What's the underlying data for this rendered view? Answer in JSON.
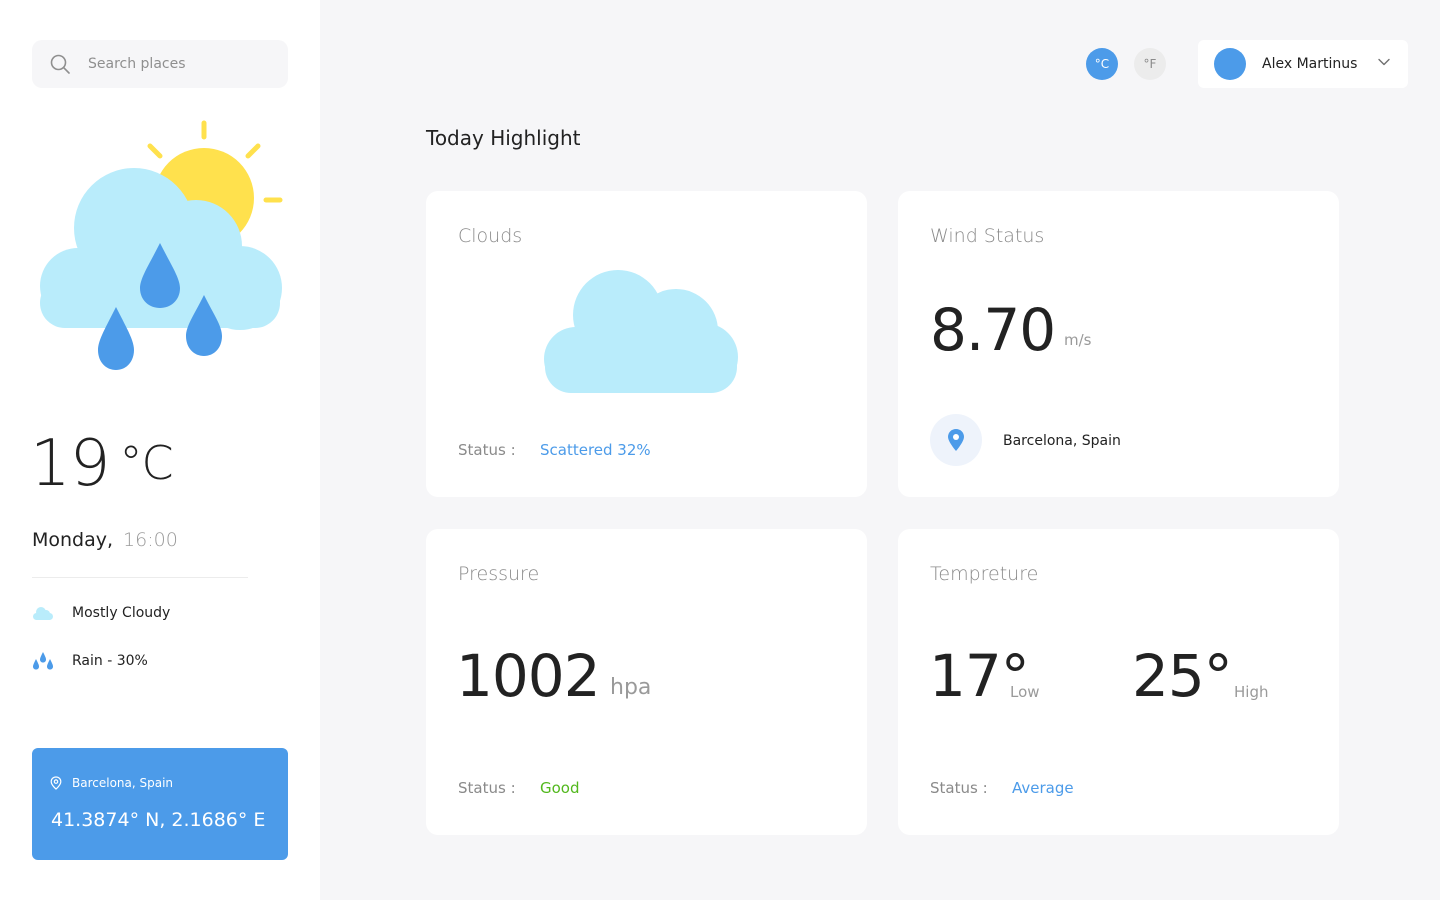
{
  "search": {
    "placeholder": "Search places"
  },
  "current": {
    "temperature": "19",
    "unit": "°C",
    "day": "Monday,",
    "time": "16:00",
    "conditions": [
      {
        "icon": "cloud-icon",
        "label": "Mostly Cloudy"
      },
      {
        "icon": "rain-drops-icon",
        "label": "Rain - 30%"
      }
    ]
  },
  "location_card": {
    "city": "Barcelona, Spain",
    "coordinates": "41.3874° N, 2.1686° E"
  },
  "units": {
    "celsius": "°C",
    "fahrenheit": "°F",
    "selected": "celsius"
  },
  "user": {
    "name": "Alex Martinus"
  },
  "highlight": {
    "title": "Today Highlight",
    "clouds": {
      "label": "Clouds",
      "status_key": "Status :",
      "status_value": "Scattered 32%"
    },
    "wind": {
      "label": "Wind Status",
      "value": "8.70",
      "unit": "m/s",
      "location": "Barcelona, Spain"
    },
    "pressure": {
      "label": "Pressure",
      "value": "1002",
      "unit": "hpa",
      "status_key": "Status :",
      "status_value": "Good"
    },
    "temperature": {
      "label": "Tempreture",
      "low_value": "17°",
      "low_label": "Low",
      "high_value": "25°",
      "high_label": "High",
      "status_key": "Status :",
      "status_value": "Average"
    }
  },
  "colors": {
    "accent": "#4c9be9",
    "good": "#52b81d",
    "cloud": "#b9ecfb",
    "sun": "#ffe14d"
  }
}
